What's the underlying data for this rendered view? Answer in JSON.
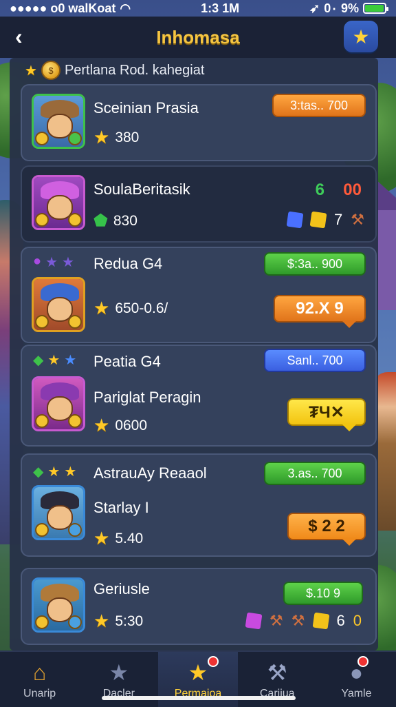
{
  "status": {
    "carrier": "●●●●● o0 walKoat",
    "time": "1:3 1M",
    "battery_text": "0٠ 9%",
    "battery_level": 0.9
  },
  "header": {
    "title": "Inhomasa",
    "back_icon": "chevron-left-icon",
    "star_icon": "star-icon"
  },
  "subheader": {
    "text": "Pertlana Rod. kahegiat"
  },
  "cards": [
    {
      "name": "Sceinian Prasia",
      "score": "380",
      "price": "3:tаs.. 700"
    },
    {
      "name": "SoulaBeritasik",
      "score": "830",
      "count_a": "6",
      "count_b": "00",
      "reward_count": "7"
    },
    {
      "name": "Redua G4",
      "score": "650-0.6/",
      "button": "$:3а.. 900",
      "price": "92.Х 9"
    },
    {
      "name": "Peatia G4",
      "subtitle": "Pariglat Peragin",
      "score": "0600",
      "button": "Sanl.. 700",
      "price": "₮Ч✕"
    },
    {
      "name": "AstrauAy Reaaol",
      "subtitle": "Starlay I",
      "score": "5.40",
      "button": "3.as.. 700",
      "price": "$ 2 2"
    },
    {
      "name": "Geriusle",
      "score": "5:30",
      "button": "$.10 9",
      "count": "6",
      "count2": "0"
    }
  ],
  "nav": [
    {
      "label": "Unarip",
      "icon": "house-icon"
    },
    {
      "label": "Dacler",
      "icon": "star-icon"
    },
    {
      "label": "Permaioa",
      "icon": "star-icon"
    },
    {
      "label": "Cariiua",
      "icon": "crafting-icon"
    },
    {
      "label": "Yamle",
      "icon": "chat-icon"
    }
  ],
  "colors": {
    "accent_gold": "#f5c542",
    "panel": "#283248",
    "button_orange": "#e0741a",
    "button_green": "#2f9a2a",
    "button_blue": "#3a5fe0"
  }
}
